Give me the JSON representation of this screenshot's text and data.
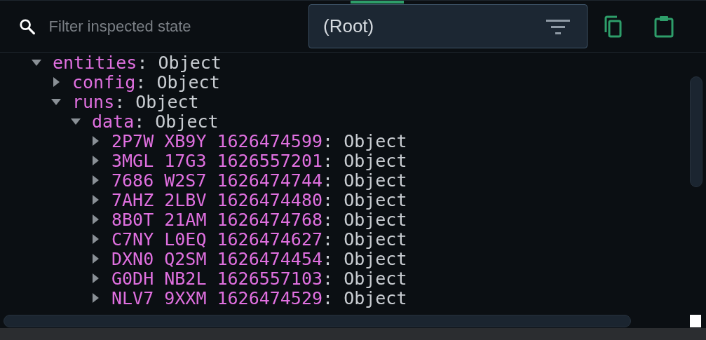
{
  "filter": {
    "placeholder": "Filter inspected state"
  },
  "path_select": {
    "value": "(Root)"
  },
  "tree": [
    {
      "key": "entities",
      "value": ": Object",
      "expanded": true,
      "children": [
        {
          "key": "config",
          "value": ": Object",
          "expanded": false
        },
        {
          "key": "runs",
          "value": ": Object",
          "expanded": true,
          "children": [
            {
              "key": "data",
              "value": ": Object",
              "expanded": true,
              "children": [
                {
                  "key": "2P7W XB9Y 1626474599",
                  "value": ": Object",
                  "expanded": false
                },
                {
                  "key": "3MGL 17G3 1626557201",
                  "value": ": Object",
                  "expanded": false
                },
                {
                  "key": "7686 W2S7 1626474744",
                  "value": ": Object",
                  "expanded": false
                },
                {
                  "key": "7AHZ 2LBV 1626474480",
                  "value": ": Object",
                  "expanded": false
                },
                {
                  "key": "8B0T 21AM 1626474768",
                  "value": ": Object",
                  "expanded": false
                },
                {
                  "key": "C7NY L0EQ 1626474627",
                  "value": ": Object",
                  "expanded": false
                },
                {
                  "key": "DXN0 Q2SM 1626474454",
                  "value": ": Object",
                  "expanded": false
                },
                {
                  "key": "G0DH NB2L 1626557103",
                  "value": ": Object",
                  "expanded": false
                },
                {
                  "key": "NLV7 9XXM 1626474529",
                  "value": ": Object",
                  "expanded": false
                }
              ]
            }
          ]
        }
      ]
    }
  ]
}
